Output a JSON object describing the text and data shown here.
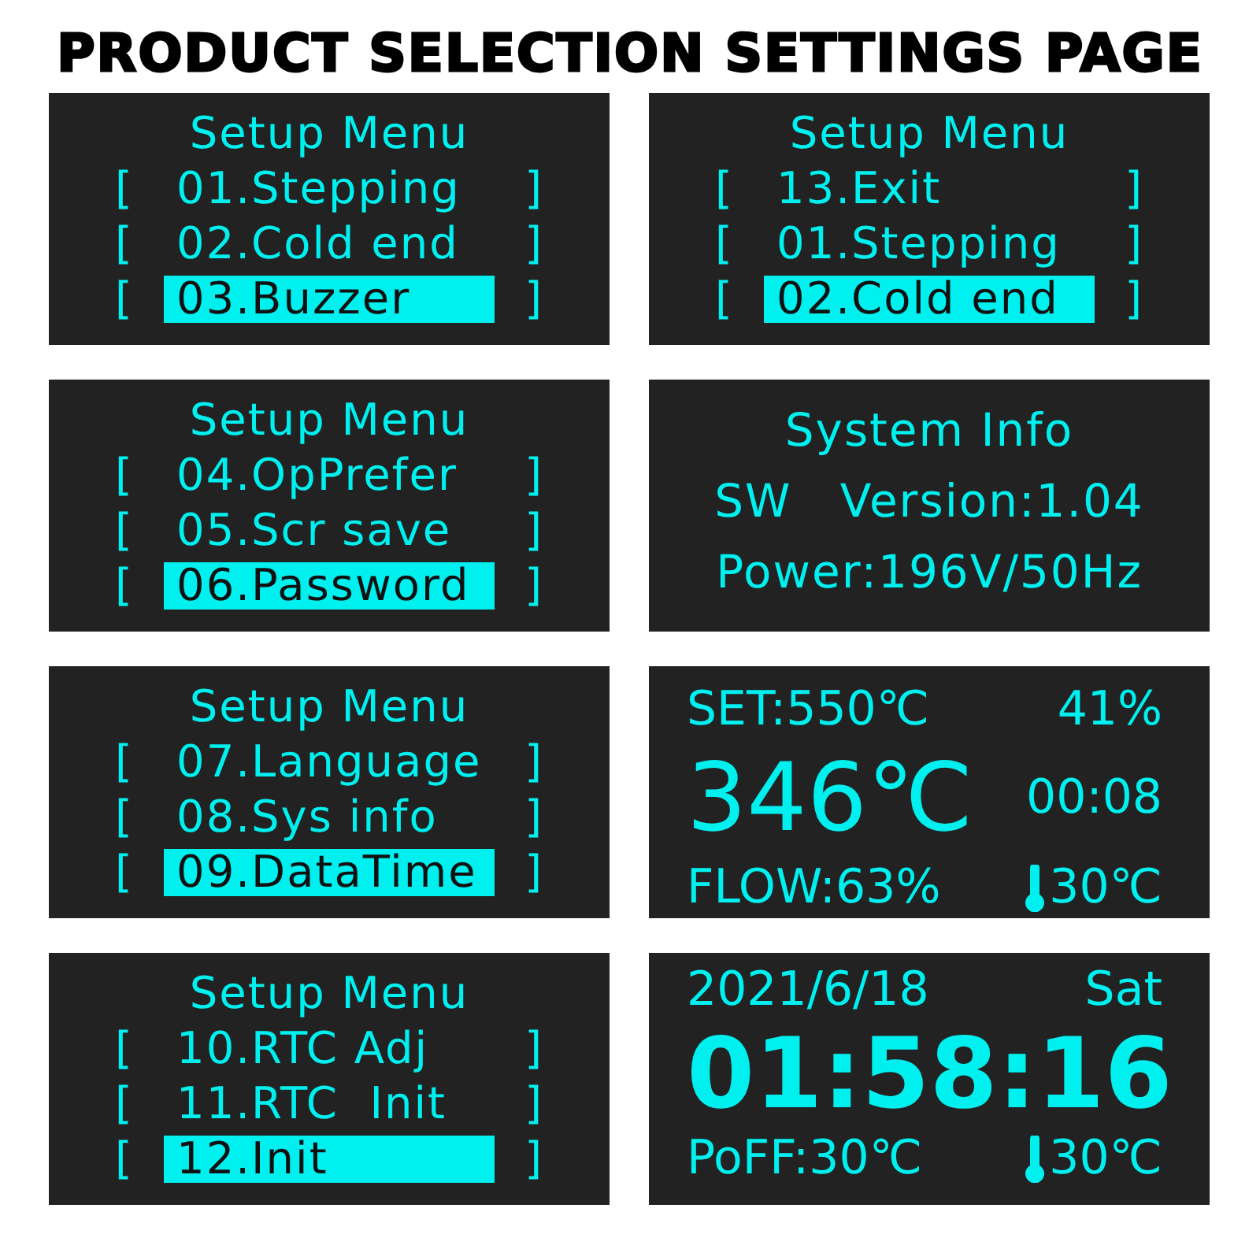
{
  "title": "PRODUCT SELECTION SETTINGS PAGE",
  "panels": [
    {
      "kind": "menu",
      "heading": "Setup Menu",
      "items": [
        {
          "open": "[",
          "label": "01.Stepping",
          "close": "]",
          "selected": false
        },
        {
          "open": "[",
          "label": "02.Cold end",
          "close": "]",
          "selected": false
        },
        {
          "open": "[",
          "label": "03.Buzzer",
          "close": "]",
          "selected": true
        }
      ]
    },
    {
      "kind": "menu",
      "heading": "Setup Menu",
      "items": [
        {
          "open": "[",
          "label": "13.Exit",
          "close": "]",
          "selected": false
        },
        {
          "open": "[",
          "label": "01.Stepping",
          "close": "]",
          "selected": false
        },
        {
          "open": "[",
          "label": "02.Cold end",
          "close": "]",
          "selected": true
        }
      ]
    },
    {
      "kind": "menu",
      "heading": "Setup Menu",
      "items": [
        {
          "open": "[",
          "label": "04.OpPrefer",
          "close": "]",
          "selected": false
        },
        {
          "open": "[",
          "label": "05.Scr save",
          "close": "]",
          "selected": false
        },
        {
          "open": "[",
          "label": "06.Password",
          "close": "]",
          "selected": true
        }
      ]
    },
    {
      "kind": "info",
      "heading": "System Info",
      "lines": [
        "SW   Version:1.04",
        "Power:196V/50Hz"
      ]
    },
    {
      "kind": "menu",
      "heading": "Setup Menu",
      "items": [
        {
          "open": "[",
          "label": "07.Language",
          "close": "]",
          "selected": false
        },
        {
          "open": "[",
          "label": "08.Sys info",
          "close": "]",
          "selected": false
        },
        {
          "open": "[",
          "label": "09.DataTime",
          "close": "]",
          "selected": true
        }
      ]
    },
    {
      "kind": "status",
      "set": "SET:550℃",
      "power": "41%",
      "temperature": "346℃",
      "timer": "00:08",
      "flow": "FLOW:63%",
      "ambient": "30℃"
    },
    {
      "kind": "menu",
      "heading": "Setup Menu",
      "items": [
        {
          "open": "[",
          "label": "10.RTC Adj",
          "close": "]",
          "selected": false
        },
        {
          "open": "[",
          "label": "11.RTC  Init",
          "close": "]",
          "selected": false
        },
        {
          "open": "[",
          "label": "12.Init",
          "close": "]",
          "selected": true
        }
      ]
    },
    {
      "kind": "clock",
      "date": "2021/6/18",
      "day": "Sat",
      "time": "01:58:16",
      "poff": "PoFF:30℃",
      "ambient": "30℃"
    }
  ]
}
